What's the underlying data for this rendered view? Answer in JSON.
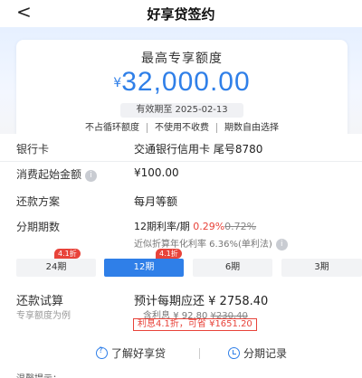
{
  "nav": {
    "back_icon": "chevron-left-icon",
    "back_glyph": "<",
    "title": "好享贷签约"
  },
  "hero": {
    "label": "最高专享额度",
    "currency": "¥",
    "amount": "32,000.00",
    "validity": "有效期至 2025-02-13",
    "features": [
      "不占循环额度",
      "不使用不收费",
      "期数自由选择"
    ]
  },
  "details": {
    "bank_card": {
      "label": "银行卡",
      "value": "交通银行信用卡 尾号8780"
    },
    "min_amount": {
      "label": "消费起始金额",
      "info": "i",
      "value": "¥100.00"
    },
    "repay_plan": {
      "label": "还款方案",
      "value": "每月等额"
    },
    "installments": {
      "label": "分期期数",
      "rate_prefix": "12期利率/期",
      "rate_new": "0.29%",
      "rate_old": "0.72%",
      "annual_line": "近似折算年化利率 6.36%(单利法)",
      "annual_info": "i",
      "tabs": [
        {
          "label": "24期",
          "badge": "4.1折",
          "active": false
        },
        {
          "label": "12期",
          "badge": "4.1折",
          "active": true
        },
        {
          "label": "6期",
          "badge": "",
          "active": false
        },
        {
          "label": "3期",
          "badge": "",
          "active": false
        }
      ]
    },
    "trial": {
      "label": "还款试算",
      "sublabel": "专享额度为例",
      "monthly_text": "预计每期应还",
      "monthly_value": "¥ 2758.40",
      "interest_prefix": "含利息",
      "interest_new": "¥ 92.80",
      "interest_old": "¥230.40",
      "discount_tag": "利息4.1折，可省 ¥1651.20"
    }
  },
  "bottom": {
    "learn_link": "了解好享贷",
    "records_link": "分期记录",
    "footnote": "温馨提示："
  },
  "colors": {
    "accent": "#2f7fe8",
    "red": "#e8433a"
  }
}
